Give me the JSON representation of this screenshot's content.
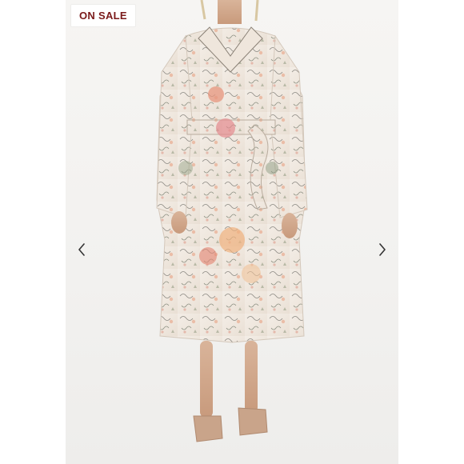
{
  "badge": {
    "label": "ON SALE",
    "color": "#7a1a1a"
  },
  "carousel": {
    "prev_icon": "chevron-left-icon",
    "next_icon": "chevron-right-icon"
  },
  "image": {
    "subject": "model-in-floral-shirt-dress"
  }
}
